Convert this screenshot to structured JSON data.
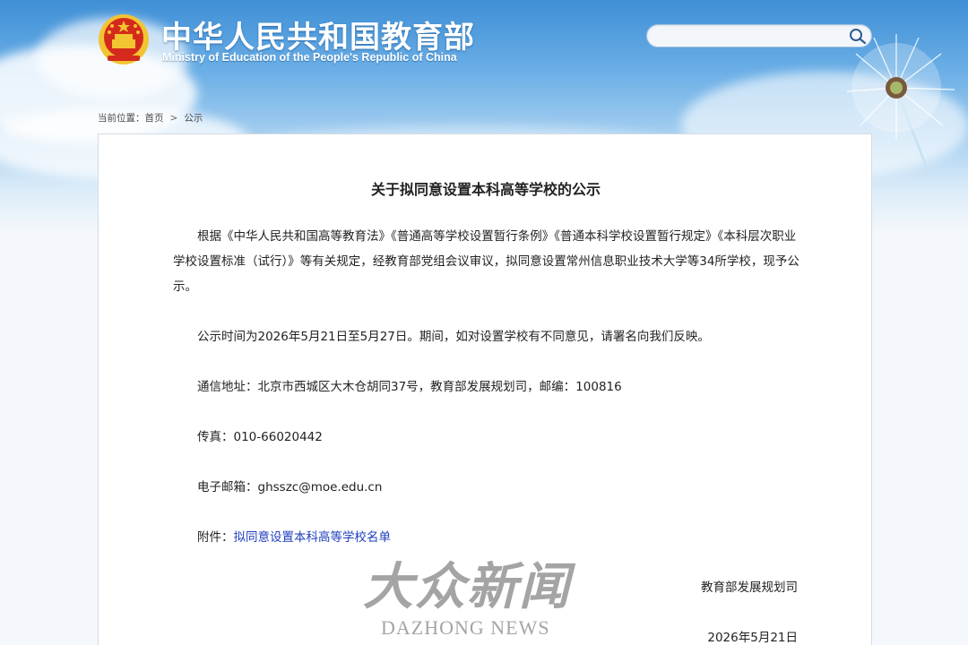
{
  "header": {
    "title": "中华人民共和国教育部",
    "subtitle": "Ministry of Education of the People's Republic of China",
    "emblem_icon": "national-emblem-icon",
    "search": {
      "value": "",
      "placeholder": "",
      "button_icon": "search-icon"
    }
  },
  "breadcrumb": {
    "prefix": "当前位置：",
    "home": "首页",
    "separator": ">",
    "current": "公示"
  },
  "article": {
    "title": "关于拟同意设置本科高等学校的公示",
    "paragraph1": "根据《中华人民共和国高等教育法》《普通高等学校设置暂行条例》《普通本科学校设置暂行规定》《本科层次职业学校设置标准（试行）》等有关规定，经教育部党组会议审议，拟同意设置常州信息职业技术大学等34所学校，现予公示。",
    "period": "公示时间为2026年5月21日至5月27日。期间，如对设置学校有不同意见，请署名向我们反映。",
    "address": "通信地址：北京市西城区大木仓胡同37号，教育部发展规划司，邮编：100816",
    "fax": "传真：010-66020442",
    "email": "电子邮箱：ghsszc@moe.edu.cn",
    "attachment_label": "附件：",
    "attachment_link": "拟同意设置本科高等学校名单",
    "signature_org": "教育部发展规划司",
    "signature_date": "2026年5月21日"
  },
  "watermark": {
    "cn": "大众新闻",
    "en": "DAZHONG NEWS"
  },
  "colors": {
    "sky_top": "#3f8fd6",
    "link": "#1f3fbf",
    "emblem_red": "#d42a1c",
    "emblem_gold": "#f3c431"
  }
}
